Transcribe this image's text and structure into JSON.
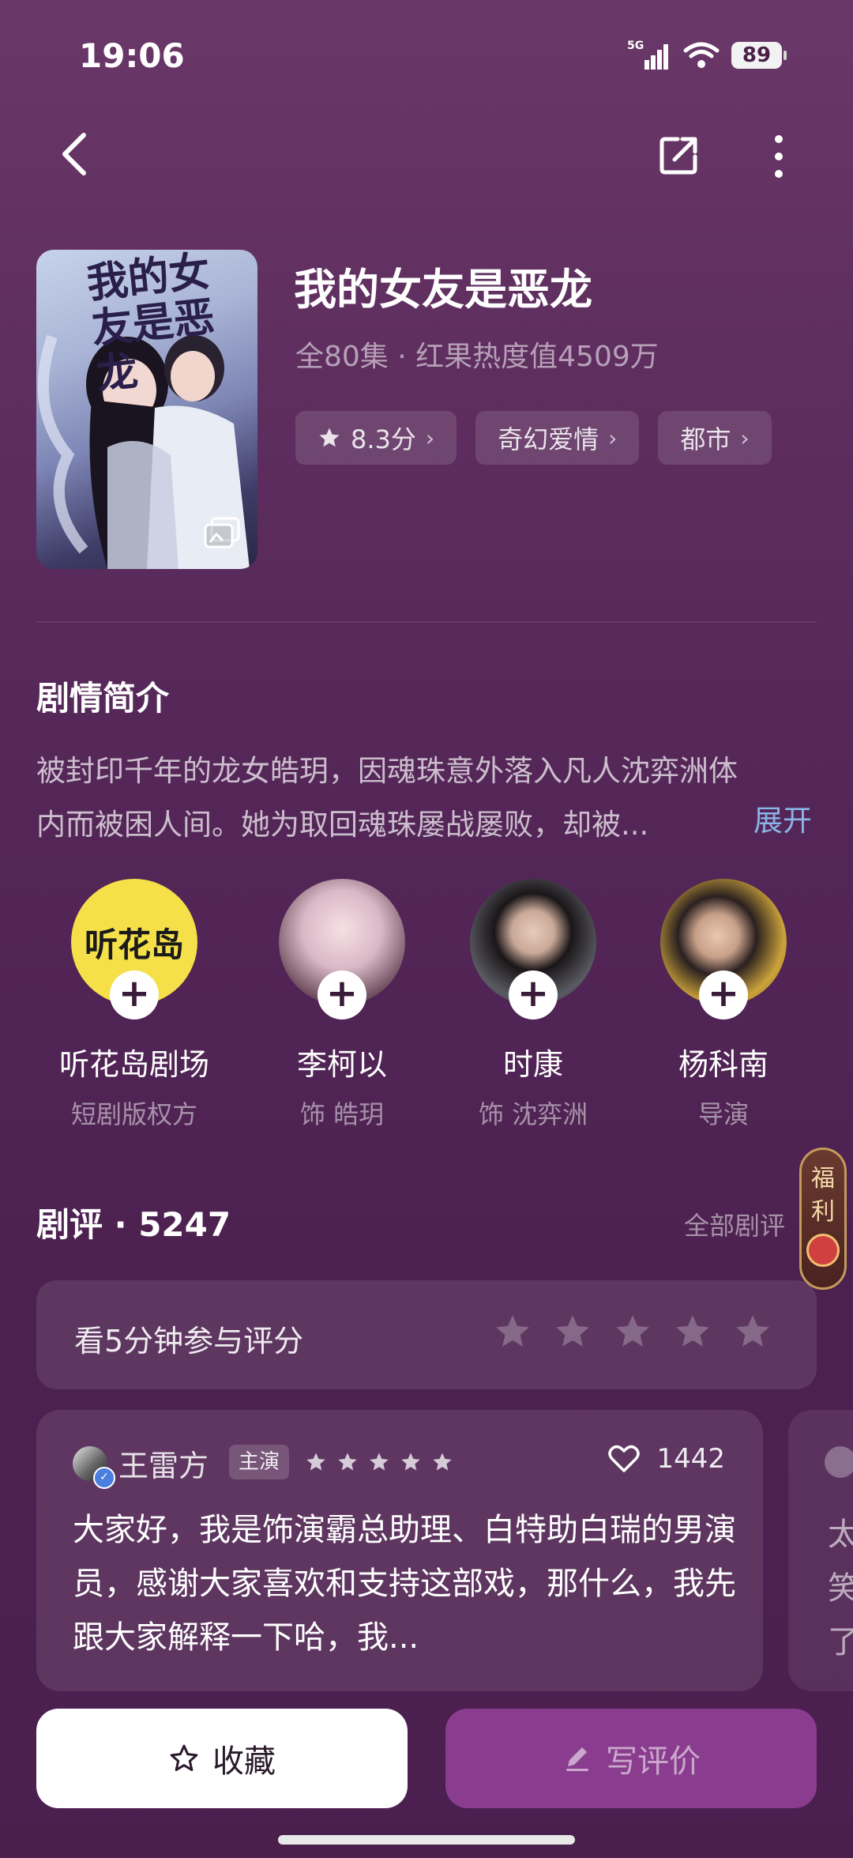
{
  "status_bar": {
    "time": "19:06",
    "network": "5G",
    "battery": "89"
  },
  "show": {
    "title": "我的女友是恶龙",
    "poster_text": "我的女友是恶龙",
    "meta": "全80集 · 红果热度值4509万",
    "tags": [
      {
        "label": "8.3分",
        "icon": "star-icon"
      },
      {
        "label": "奇幻爱情"
      },
      {
        "label": "都市"
      }
    ]
  },
  "synopsis": {
    "heading": "剧情简介",
    "text": "被封印千年的龙女皓玥，因魂珠意外落入凡人沈弈洲体内而被困人间。她为取回魂珠屡战屡败，却被...",
    "expand_label": "展开"
  },
  "cast": [
    {
      "name": "听花岛剧场",
      "role": "短剧版权方",
      "logo_text": "听花岛",
      "avatar_color": "#f5e04a"
    },
    {
      "name": "李柯以",
      "role": "饰 皓玥",
      "avatar_color": "#d9b8c6"
    },
    {
      "name": "时康",
      "role": "饰 沈弈洲",
      "avatar_color": "#5a5a62"
    },
    {
      "name": "杨科南",
      "role": "导演",
      "avatar_color": "#caa23a"
    }
  ],
  "reviews": {
    "heading": "剧评 · 5247",
    "all_label": "全部剧评",
    "rate_prompt": "看5分钟参与评分",
    "rating_stars": 5,
    "items": [
      {
        "author": "王雷方",
        "badge": "主演",
        "stars": 5,
        "likes": "1442",
        "text": "大家好，我是饰演霸总助理、白特助白瑞的男演员，感谢大家喜欢和支持这部戏，那什么，我先跟大家解释一下哈，我..."
      }
    ],
    "next_preview": "太笑了"
  },
  "welfare": {
    "label": "福利"
  },
  "actions": {
    "favorite_label": "收藏",
    "write_label": "写评价"
  },
  "colors": {
    "accent": "#8a3d8e",
    "link": "#8ab4e6",
    "background": "#5a2a5c"
  }
}
